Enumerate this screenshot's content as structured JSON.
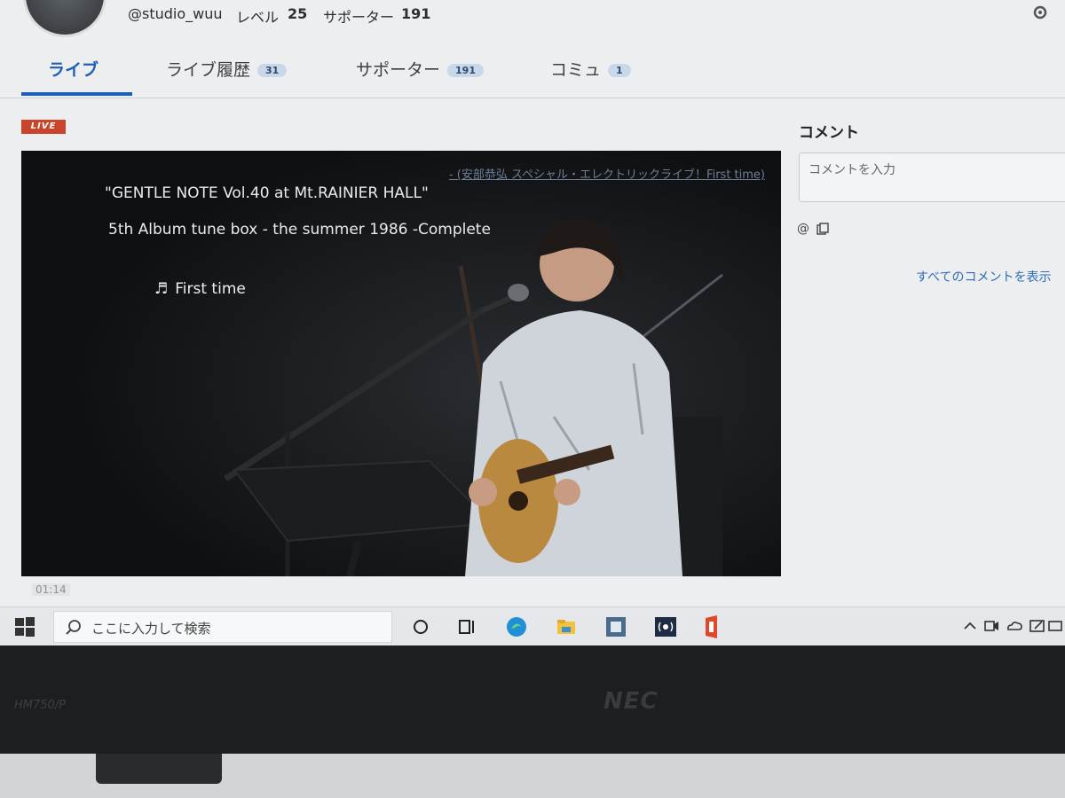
{
  "profile": {
    "username": "@studio_wuu",
    "level_label": "レベル",
    "level_value": "25",
    "supporters_label": "サポーター",
    "supporters_value": "191"
  },
  "tabs": [
    {
      "label": "ライブ",
      "badge": ""
    },
    {
      "label": "ライブ履歴",
      "badge": "31"
    },
    {
      "label": "サポーター",
      "badge": "191"
    },
    {
      "label": "コミュ",
      "badge": "1"
    }
  ],
  "live_badge": "LIVE",
  "video": {
    "source_link": "- (安部恭弘 スペシャル・エレクトリックライブ！First time)",
    "title_line1": "\"GENTLE NOTE Vol.40 at Mt.RAINIER HALL\"",
    "title_line2": "5th Album tune box - the summer 1986 -Complete",
    "song_title": "First time",
    "song_icon": "music-note-icon",
    "elapsed_time": "01:14"
  },
  "comments": {
    "heading": "コメント",
    "input_placeholder": "コメントを入力",
    "mention_icon": "@",
    "copy_icon": "copy-icon",
    "show_all_label": "すべてのコメントを表示"
  },
  "taskbar": {
    "search_placeholder": "ここに入力して検索",
    "apps": [
      "cortana-icon",
      "task-view-icon",
      "edge-icon",
      "file-explorer-icon",
      "app-icon",
      "broadcast-icon",
      "office-icon"
    ],
    "tray": [
      "chevron-up-icon",
      "meet-now-icon",
      "onedrive-icon",
      "pen-icon",
      "network-icon"
    ]
  },
  "laptop": {
    "model": "HM750/P",
    "brand": "NEC"
  },
  "colors": {
    "accent": "#1d5fb8",
    "live_badge": "#c8452b"
  }
}
